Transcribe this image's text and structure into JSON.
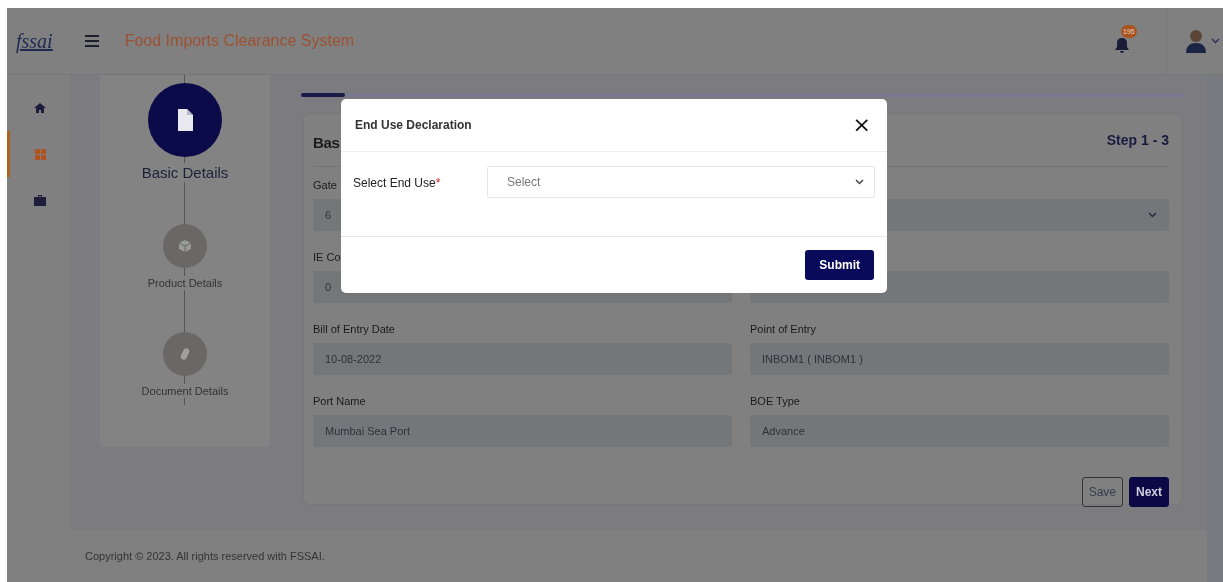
{
  "header": {
    "logo": "fssai",
    "title": "Food Imports Clearance System",
    "notification_count": "195"
  },
  "sidebar": {
    "items": [
      {
        "selected": false
      },
      {
        "selected": true
      },
      {
        "selected": false
      }
    ]
  },
  "stepper": {
    "steps": [
      {
        "label": "Basic Details",
        "selected": true
      },
      {
        "label": "Product Details",
        "selected": false
      },
      {
        "label": "Document Details",
        "selected": false
      }
    ]
  },
  "progress": {
    "level": 0.05
  },
  "form": {
    "title": "Bas",
    "step": "Step 1 - 3",
    "rows": [
      {
        "left": {
          "label": "Gate",
          "value": "6",
          "kind": "text"
        },
        "right": {
          "kind": "select"
        }
      },
      {
        "left": {
          "label": "IE Co",
          "value": "0",
          "kind": "text"
        },
        "right": {
          "kind": "text"
        }
      },
      {
        "left": {
          "label": "Bill of Entry Date",
          "value": "10-08-2022",
          "kind": "text"
        },
        "right": {
          "label": "Point of Entry",
          "value": "INBOM1 ( INBOM1 )",
          "kind": "text"
        }
      },
      {
        "left": {
          "label": "Port Name",
          "value": "Mumbai Sea Port",
          "kind": "text"
        },
        "right": {
          "label": "BOE Type",
          "value": "Advance",
          "kind": "text"
        }
      }
    ],
    "buttons": [
      {
        "label": "Save",
        "kind": "outline"
      },
      {
        "label": "Next",
        "kind": "primary"
      }
    ]
  },
  "footer": "Copyright © 2023. All rights reserved with FSSAI.",
  "modal": {
    "title": "End Use Declaration",
    "close": "×",
    "field": {
      "label": "Select End Use",
      "required_mark": "*",
      "placeholder": "Select"
    },
    "submit": "Submit"
  }
}
